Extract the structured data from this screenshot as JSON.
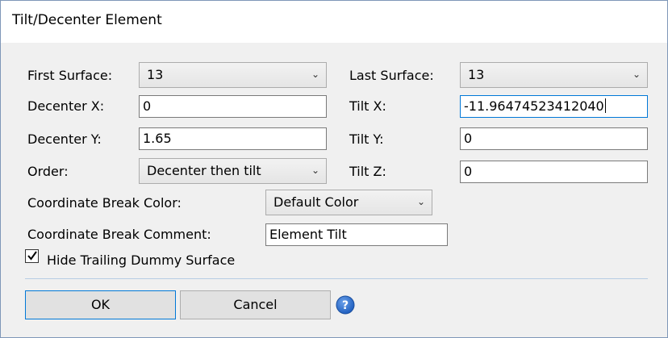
{
  "window": {
    "title": "Tilt/Decenter Element"
  },
  "form": {
    "first_surface": {
      "label": "First Surface:",
      "value": "13"
    },
    "last_surface": {
      "label": "Last Surface:",
      "value": "13"
    },
    "decenter_x": {
      "label": "Decenter X:",
      "value": "0"
    },
    "tilt_x": {
      "label": "Tilt X:",
      "value": "-11.96474523412040"
    },
    "decenter_y": {
      "label": "Decenter Y:",
      "value": "1.65"
    },
    "tilt_y": {
      "label": "Tilt Y:",
      "value": "0"
    },
    "order": {
      "label": "Order:",
      "value": "Decenter then tilt"
    },
    "tilt_z": {
      "label": "Tilt Z:",
      "value": "0"
    },
    "cb_color": {
      "label": "Coordinate Break Color:",
      "value": "Default Color"
    },
    "cb_comment": {
      "label": "Coordinate Break Comment:",
      "value": "Element Tilt"
    },
    "hide_dummy": {
      "label": "Hide Trailing Dummy Surface",
      "checked": true
    }
  },
  "buttons": {
    "ok": "OK",
    "cancel": "Cancel"
  },
  "icons": {
    "dropdown": "chevron-down-icon",
    "help": "help-icon",
    "check": "check-icon"
  },
  "colors": {
    "help_blue": "#1f5fbf",
    "focus_border": "#0078d7"
  }
}
